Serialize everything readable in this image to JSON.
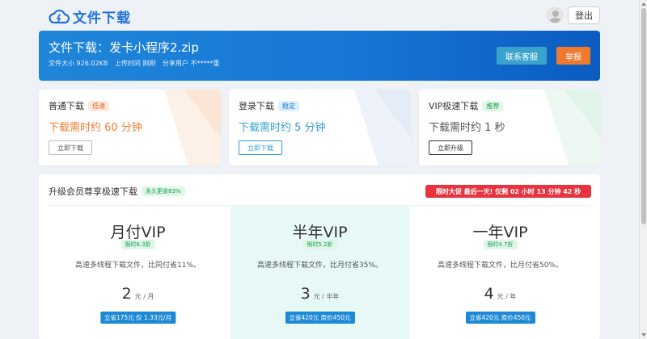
{
  "header": {
    "logo_text": "文件下载",
    "login_label": "登出"
  },
  "file": {
    "title": "文件下载：发卡小程序2.zip",
    "size": "文件大小 926.02KB",
    "upload_time": "上传时间 刚刚",
    "share_user": "分享用户 不*****重",
    "service_label": "联系客服",
    "report_label": "举报"
  },
  "options": [
    {
      "name": "普通下载",
      "badge": "低速",
      "time": "下载需时约 60 分钟",
      "action": "立即下载",
      "color": "#ef7a2d"
    },
    {
      "name": "登录下载",
      "badge": "稳定",
      "time": "下载需时约 5 分钟",
      "action": "立即下载",
      "color": "#2f9fd0"
    },
    {
      "name": "VIP极速下载",
      "badge": "推荐",
      "time": "下载需时约 1 秒",
      "action": "立即升级",
      "color": "#555555"
    }
  ],
  "vip": {
    "heading": "升级会员尊享极速下载",
    "heading_badge": "永久更省83%",
    "promo": "限时大促 最后一天! 仅剩 02 小时 13 分钟 42 秒",
    "plans": [
      {
        "name": "月付VIP",
        "discount": "限时6.3折",
        "desc": "高速多线程下载文件，比同付省11%。",
        "price": "2",
        "unit": "元 / 月",
        "save": "立省175元 仅 1.33元/月"
      },
      {
        "name": "半年VIP",
        "discount": "限时5.2折",
        "desc": "高速多线程下载文件，比月付省35%。",
        "price": "3",
        "unit": "元 / 半年",
        "save": "立省420元 原价450元"
      },
      {
        "name": "一年VIP",
        "discount": "限时4.7折",
        "desc": "高速多线程下载文件，比月付省50%。",
        "price": "4",
        "unit": "元 / 年",
        "save": "立省420元 原价450元"
      }
    ]
  },
  "colors": {
    "brand": "#1f72d8",
    "banner": "#1777d5",
    "service": "#3aa3cc",
    "report": "#ef7a2d",
    "promo": "#e8343f"
  }
}
